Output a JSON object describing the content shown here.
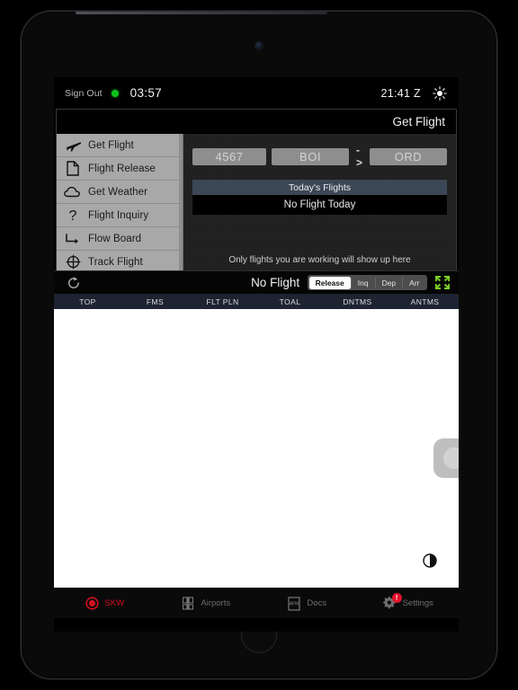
{
  "status_bar": {
    "sign_out_label": "Sign Out",
    "online_indicator": "online",
    "local_time": "03:57",
    "zulu_time": "21:41 Z",
    "brightness_icon": "sun-icon"
  },
  "get_flight_panel": {
    "title": "Get Flight",
    "menu": [
      {
        "label": "Get Flight",
        "icon": "airplane-icon"
      },
      {
        "label": "Flight Release",
        "icon": "document-icon"
      },
      {
        "label": "Get Weather",
        "icon": "cloud-icon"
      },
      {
        "label": "Flight Inquiry",
        "icon": "question-mark-icon"
      },
      {
        "label": "Flow Board",
        "icon": "flow-arrow-icon"
      },
      {
        "label": "Track Flight",
        "icon": "crosshair-icon"
      }
    ],
    "fields": {
      "flight_number_placeholder": "4567",
      "origin_placeholder": "BOI",
      "arrow": "->",
      "destination_placeholder": "ORD"
    },
    "todays_flights_header": "Today's Flights",
    "todays_flights_body": "No Flight Today",
    "hint": "Only flights you are working will show up here"
  },
  "toolbar": {
    "refresh_icon": "refresh-icon",
    "flight_status": "No Flight",
    "segments": [
      {
        "label": "Release",
        "selected": true
      },
      {
        "label": "Inq",
        "selected": false
      },
      {
        "label": "Dep",
        "selected": false
      },
      {
        "label": "Arr",
        "selected": false
      }
    ],
    "expand_icon": "expand-arrows-icon"
  },
  "table": {
    "columns": [
      "TOP",
      "FMS",
      "FLT PLN",
      "TOAL",
      "DNTMS",
      "ANTMS"
    ],
    "rows": []
  },
  "content_overlay": {
    "float_widget_icon": "assistive-touch-icon",
    "contrast_icon": "contrast-icon"
  },
  "tab_bar": [
    {
      "label": "SKW",
      "icon": "record-circle-icon",
      "active": true,
      "badge": null
    },
    {
      "label": "Airports",
      "icon": "airport-terminal-icon",
      "active": false,
      "badge": null
    },
    {
      "label": "Docs",
      "icon": "afm-document-icon",
      "active": false,
      "badge": null
    },
    {
      "label": "Settings",
      "icon": "gear-icon",
      "active": false,
      "badge": "!"
    }
  ],
  "colors": {
    "accent_red": "#cf1020",
    "online_green": "#11c21b",
    "expand_green": "#7ccf28",
    "header_navy": "#1d2330",
    "flights_header_slate": "#3c4756",
    "menu_gray": "#a8a8a8"
  }
}
